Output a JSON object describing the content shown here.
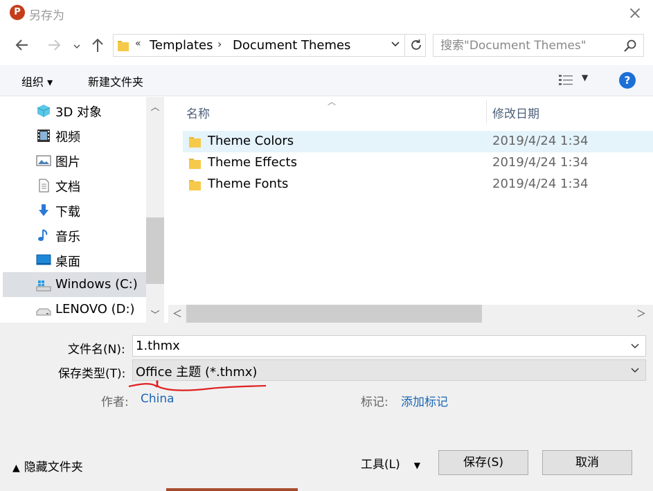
{
  "window": {
    "title": "另存为",
    "app_icon_letter": "P",
    "app_color": "#c43e1c"
  },
  "nav": {
    "back_icon": "arrow-left-icon",
    "forward_icon": "arrow-right-icon",
    "up_icon": "arrow-up-icon",
    "breadcrumb": [
      "Templates",
      "Document Themes"
    ],
    "breadcrumb_overflow": "«",
    "search_placeholder": "搜索\"Document Themes\""
  },
  "toolbar": {
    "organize_label": "组织 ▾",
    "new_folder_label": "新建文件夹",
    "help_label": "?"
  },
  "sidebar": {
    "items": [
      {
        "label": "3D 对象",
        "icon": "cube-3d-icon"
      },
      {
        "label": "视频",
        "icon": "video-icon"
      },
      {
        "label": "图片",
        "icon": "pictures-icon"
      },
      {
        "label": "文档",
        "icon": "document-icon"
      },
      {
        "label": "下载",
        "icon": "download-icon"
      },
      {
        "label": "音乐",
        "icon": "music-icon"
      },
      {
        "label": "桌面",
        "icon": "desktop-icon"
      },
      {
        "label": "Windows (C:)",
        "icon": "windows-drive-icon",
        "selected": true
      },
      {
        "label": "LENOVO (D:)",
        "icon": "drive-icon"
      }
    ]
  },
  "filelist": {
    "columns": {
      "name": "名称",
      "modified": "修改日期"
    },
    "rows": [
      {
        "name": "Theme Colors",
        "modified": "2019/4/24 1:34",
        "selected": true
      },
      {
        "name": "Theme Effects",
        "modified": "2019/4/24 1:34"
      },
      {
        "name": "Theme Fonts",
        "modified": "2019/4/24 1:34"
      }
    ]
  },
  "form": {
    "filename_label": "文件名(N):",
    "filename_value": "1.thmx",
    "filetype_label": "保存类型(T):",
    "filetype_value": "Office 主题 (*.thmx)",
    "author_label": "作者:",
    "author_value": "China",
    "tags_label": "标记:",
    "tags_value": "添加标记"
  },
  "footer": {
    "hide_folders_label": "隐藏文件夹",
    "tools_label": "工具(L)",
    "save_label": "保存(S)",
    "cancel_label": "取消"
  },
  "colors": {
    "selection": "#e5f3fb",
    "link": "#1a66b3",
    "annotation": "#e02020"
  }
}
